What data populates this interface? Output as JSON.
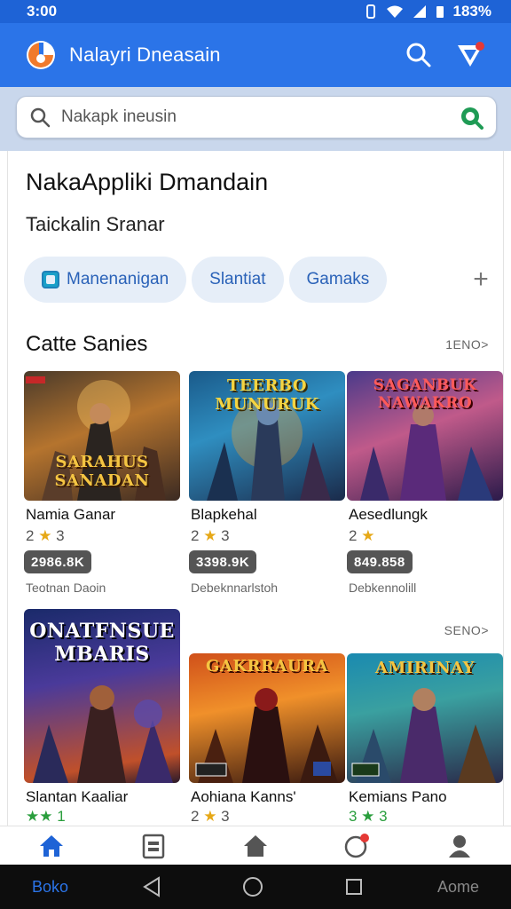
{
  "status_bar": {
    "time": "3:00",
    "battery": "183%"
  },
  "app_bar": {
    "title": "Nalayri Dneasain"
  },
  "search": {
    "placeholder": "Nakapk ineusin"
  },
  "header": {
    "title": "NakaAppliki Dmandain",
    "subtitle": "Taickalin Sranar"
  },
  "chips": [
    {
      "label": "Manenanigan"
    },
    {
      "label": "Slantiat"
    },
    {
      "label": "Gamaks"
    }
  ],
  "section": {
    "title": "Catte Sanies",
    "see_more": "1ENO>",
    "see_more_2": "SENO>"
  },
  "games_row1": [
    {
      "cover_title": "SARAHUS SANADAN",
      "name": "Namia Ganar",
      "rating": "2 ★ 3",
      "price": "2986.8K",
      "developer": "Teotnan Daoin"
    },
    {
      "cover_title": "TEERBO MUNURUK",
      "name": "Blapkehal",
      "rating": "2 ★ 3",
      "price": "3398.9K",
      "developer": "Debeknnarlstoh"
    },
    {
      "cover_title": "SAGANBUK NAWAKRO",
      "name": "Aesedlungk",
      "rating": "2 ★",
      "price": "849.858",
      "developer": "Debkennolill"
    }
  ],
  "games_row2": [
    {
      "cover_title": "ONATFNSUE MBARIS",
      "name": "Slantan Kaaliar",
      "rating": "★★ 1"
    },
    {
      "cover_title": "GAKRRAURA",
      "name": "Aohiana Kanns'",
      "rating": "2 ★ 3"
    },
    {
      "cover_title": "AMIRINAY",
      "name": "Kemians Pano",
      "rating": "3 ★ 3"
    }
  ],
  "bottom_nav": [
    "home-icon",
    "calendar-icon",
    "store-icon",
    "notifications-icon",
    "profile-icon"
  ],
  "system_nav": {
    "left_label": "Boko",
    "right_label": "Aome"
  },
  "colors": {
    "primary": "#2b74e8",
    "status_bar": "#1e63d6",
    "search_bg": "#c9d7ec",
    "chip_bg": "#e6eef8",
    "chip_text": "#2a62b8"
  }
}
